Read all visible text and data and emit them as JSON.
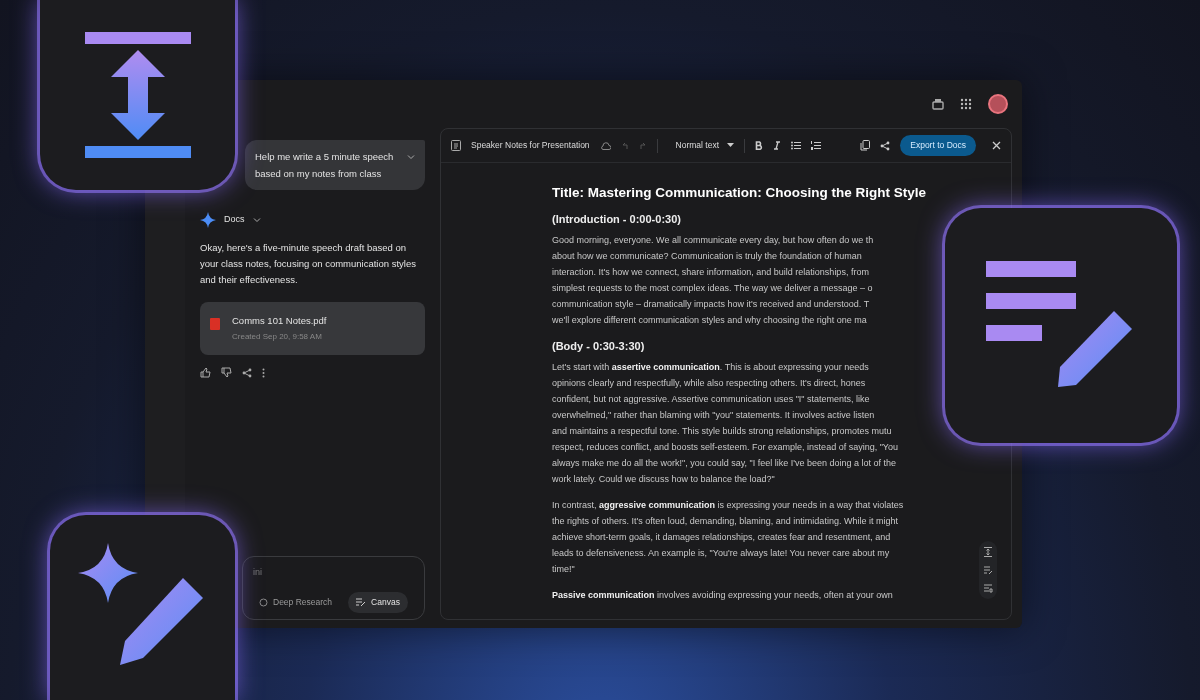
{
  "chat": {
    "prompt": "Help me write a 5 minute speech based on my notes from class",
    "source": "Docs",
    "response": "Okay, here's a five-minute speech draft based on your class notes, focusing on communication styles and their effectiveness.",
    "attachment": {
      "name": "Comms 101 Notes.pdf",
      "meta": "Created Sep 20, 9:58 AM"
    },
    "input": {
      "placeholder": "ini"
    },
    "tools": [
      {
        "label": "Deep Research",
        "selected": false
      },
      {
        "label": "Canvas",
        "selected": true
      }
    ]
  },
  "doc": {
    "name": "Speaker Notes for Presentation",
    "style": "Normal text",
    "export": "Export to Docs",
    "blocks": [
      {
        "kind": "title",
        "lines": [
          "Title: Mastering Communication: Choosing the Right Style"
        ]
      },
      {
        "kind": "heading",
        "lines": [
          "(Introduction - 0:00-0:30)"
        ]
      },
      {
        "kind": "paragraph",
        "lines": [
          "Good morning, everyone. We all communicate every day, but how often do we th",
          "about how we communicate? Communication is truly the foundation of human",
          "interaction. It's how we connect, share information, and build relationships, from",
          "simplest requests to the most complex ideas. The way we deliver a message – o",
          "communication style – dramatically impacts how it's received and understood. T",
          "we'll explore different communication styles and why choosing the right one ma"
        ]
      },
      {
        "kind": "heading",
        "lines": [
          "(Body - 0:30-3:30)"
        ]
      },
      {
        "kind": "paragraph",
        "lines": [
          "Let's start with **assertive communication**. This is about expressing your needs",
          "opinions clearly and respectfully, while also respecting others. It's direct, hones",
          "confident, but not aggressive. Assertive communication uses \"I\" statements, like",
          "overwhelmed,\" rather than blaming with \"you\" statements. It involves active listen",
          "and maintains a respectful tone. This style builds strong relationships, promotes mutu",
          "respect, reduces conflict, and boosts self-esteem. For example, instead of saying, \"You",
          "always make me do all the work!\", you could say, \"I feel like I've been doing a lot of the",
          "work lately. Could we discuss how to balance the load?\""
        ]
      },
      {
        "kind": "paragraph",
        "lines": [
          "In contrast, **aggressive communication** is expressing your needs in a way that violates",
          "the rights of others. It's often loud, demanding, blaming, and intimidating. While it might",
          "achieve short-term goals, it damages relationships, creates fear and resentment, and",
          "leads to defensiveness. An example is, \"You're always late! You never care about my",
          "time!\""
        ]
      },
      {
        "kind": "paragraph",
        "lines": [
          "**Passive communication** involves avoiding expressing your needs, often at your own"
        ]
      }
    ]
  }
}
